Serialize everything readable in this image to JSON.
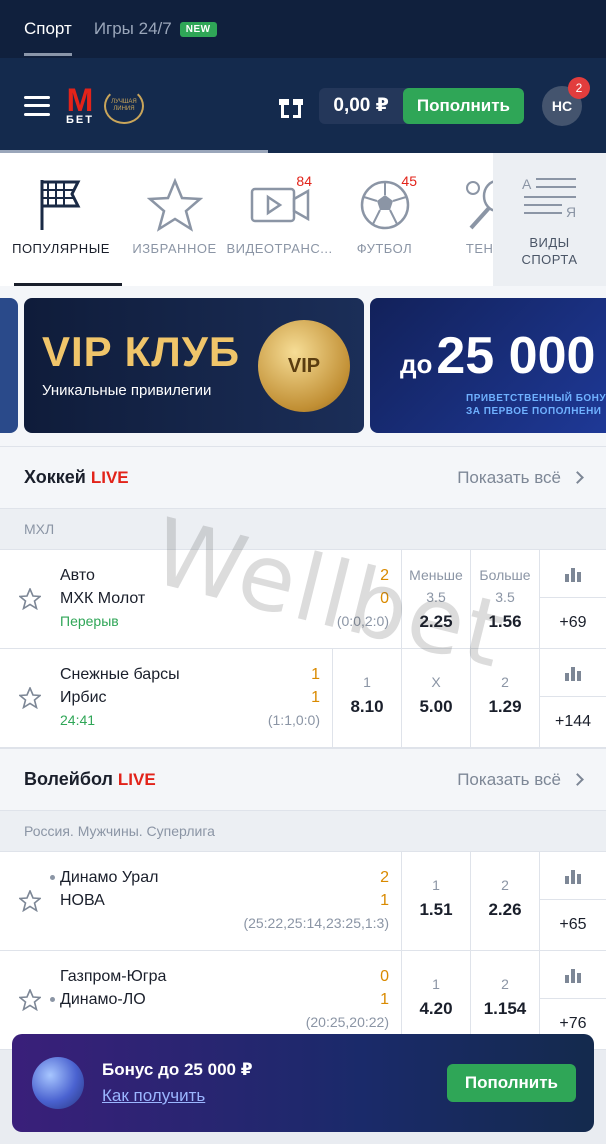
{
  "top_tabs": {
    "sport": "Спорт",
    "games": "Игры 24/7",
    "new_badge": "NEW"
  },
  "header": {
    "logo_m": "М",
    "logo_bet": "БЕТ",
    "award_text": "ЛУЧШАЯ ЛИНИЯ",
    "balance": "0,00 ₽",
    "deposit": "Пополнить",
    "avatar": "НС",
    "notifications": "2"
  },
  "sports_nav": {
    "items": [
      {
        "label": "ПОПУЛЯРНЫЕ",
        "icon": "flag-icon"
      },
      {
        "label": "ИЗБРАННОЕ",
        "icon": "star-icon"
      },
      {
        "label": "ВИДЕОТРАНС...",
        "icon": "video-icon",
        "count": "84"
      },
      {
        "label": "ФУТБОЛ",
        "icon": "football-icon",
        "count": "45"
      },
      {
        "label": "ТЕННИ",
        "icon": "tennis-icon"
      }
    ],
    "sport_types_line1": "ВИДЫ",
    "sport_types_line2": "СПОРТА"
  },
  "banners": {
    "vip_title": "VIP КЛУБ",
    "vip_sub": "Уникальные привилегии",
    "vip_coin": "VIP",
    "bonus_prefix": "до",
    "bonus_amount": "25 000",
    "bonus_line1": "ПРИВЕТСТВЕННЫЙ БОНУ",
    "bonus_line2": "ЗА ПЕРВОЕ ПОПОЛНЕНИ"
  },
  "hockey": {
    "title": "Хоккей",
    "live": "LIVE",
    "show_all": "Показать всё",
    "league": "МХЛ",
    "matches": [
      {
        "team1": "Авто",
        "team2": "МХК Молот",
        "score1": "2",
        "score2": "0",
        "status": "Перерыв",
        "detail": "(0:0,2:0)",
        "odds": [
          {
            "label1": "Меньше",
            "label2": "3.5",
            "value": "2.25"
          },
          {
            "label1": "Больше",
            "label2": "3.5",
            "value": "1.56"
          }
        ],
        "more": "+69"
      },
      {
        "team1": "Снежные барсы",
        "team2": "Ирбис",
        "score1": "1",
        "score2": "1",
        "status": "24:41",
        "detail": "(1:1,0:0)",
        "odds": [
          {
            "label": "1",
            "value": "8.10"
          },
          {
            "label": "X",
            "value": "5.00"
          },
          {
            "label": "2",
            "value": "1.29"
          }
        ],
        "more": "+144"
      }
    ]
  },
  "volleyball": {
    "title": "Волейбол",
    "live": "LIVE",
    "show_all": "Показать всё",
    "league": "Россия. Мужчины. Суперлига",
    "matches": [
      {
        "team1": "Динамо Урал",
        "team2": "НОВА",
        "score1": "2",
        "score2": "1",
        "detail": "(25:22,25:14,23:25,1:3)",
        "odds": [
          {
            "label": "1",
            "value": "1.51"
          },
          {
            "label": "2",
            "value": "2.26"
          }
        ],
        "more": "+65"
      },
      {
        "team1": "Газпром-Югра",
        "team2": "Динамо-ЛО",
        "score1": "0",
        "score2": "1",
        "detail": "(20:25,20:22)",
        "odds": [
          {
            "label": "1",
            "value": "4.20"
          },
          {
            "label": "2",
            "value": "1.154"
          }
        ],
        "more": "+76"
      }
    ]
  },
  "watermark": "Wellbet",
  "bonus_bar": {
    "title": "Бонус до 25 000 ₽",
    "link": "Как получить",
    "button": "Пополнить"
  },
  "colors": {
    "accent_green": "#2fa657",
    "brand_red": "#e2231a",
    "header_bg": "#142a4d",
    "score_orange": "#d98a00"
  }
}
